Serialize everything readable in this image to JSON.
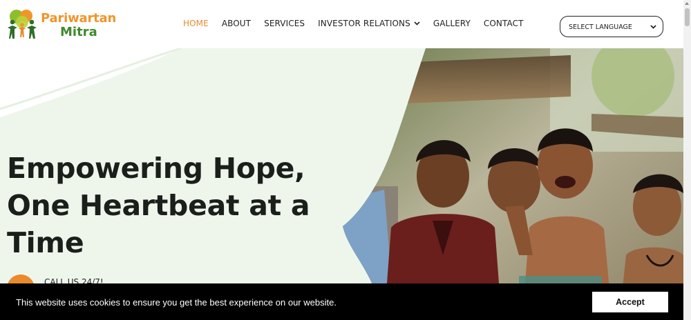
{
  "logo": {
    "line1": "Pariwartan",
    "line2": "Mitra"
  },
  "nav": {
    "items": [
      {
        "label": "HOME",
        "active": true
      },
      {
        "label": "ABOUT"
      },
      {
        "label": "SERVICES"
      },
      {
        "label": "INVESTOR RELATIONS",
        "has_dropdown": true
      },
      {
        "label": "GALLERY"
      },
      {
        "label": "CONTACT"
      }
    ]
  },
  "language_select": {
    "label": "SELECT LANGUAGE"
  },
  "hero": {
    "headline_lines": [
      "Empowering Hope,",
      "One Heartbeat at a",
      "Time"
    ],
    "call_label": "CALL US 24/7!"
  },
  "cookie_bar": {
    "message": "This website uses cookies to ensure you get the best experience on our website.",
    "accept_label": "Accept"
  },
  "colors": {
    "accent_orange": "#e98a2c",
    "logo_green": "#3f8a2a",
    "hero_bg": "#eef6ec",
    "cookie_bg": "#000000"
  }
}
